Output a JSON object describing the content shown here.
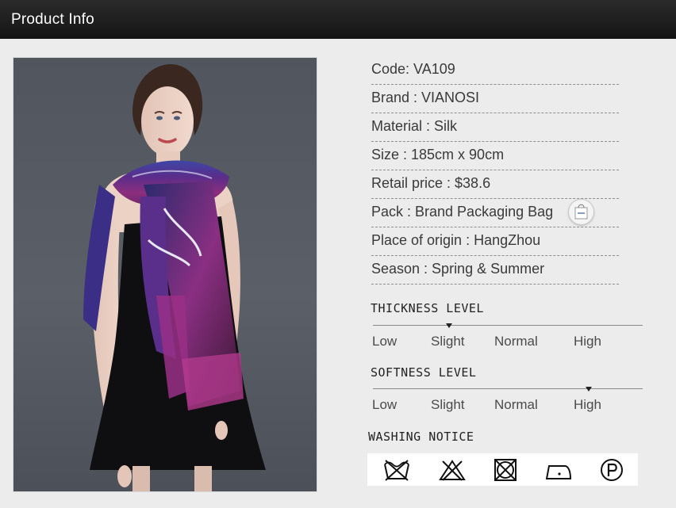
{
  "header": {
    "title": "Product Info"
  },
  "specs": [
    {
      "label": "Code: VA109"
    },
    {
      "label": "Brand : VIANOSI"
    },
    {
      "label": "Material : Silk"
    },
    {
      "label": "Size : 185cm x 90cm"
    },
    {
      "label": "Retail price : $38.6"
    },
    {
      "label": "Pack : Brand Packaging Bag"
    },
    {
      "label": "Place of origin : HangZhou"
    },
    {
      "label": "Season : Spring & Summer"
    }
  ],
  "thickness": {
    "title": "THICKNESS LEVEL",
    "levels": [
      "Low",
      "Slight",
      "Normal",
      "High"
    ],
    "selected": "Slight"
  },
  "softness": {
    "title": "SOFTNESS LEVEL",
    "levels": [
      "Low",
      "Slight",
      "Normal",
      "High"
    ],
    "selected": "High"
  },
  "washing": {
    "title": "WASHING NOTICE",
    "icons": [
      "do-not-wash-icon",
      "do-not-bleach-icon",
      "do-not-tumble-dry-icon",
      "iron-low-heat-icon",
      "professional-dry-clean-icon"
    ]
  },
  "colors": {
    "header_bg": "#1c1c1c",
    "page_bg": "#ececec",
    "scarf_purple": "#7a2a78",
    "scarf_blue": "#3a3f9a"
  }
}
